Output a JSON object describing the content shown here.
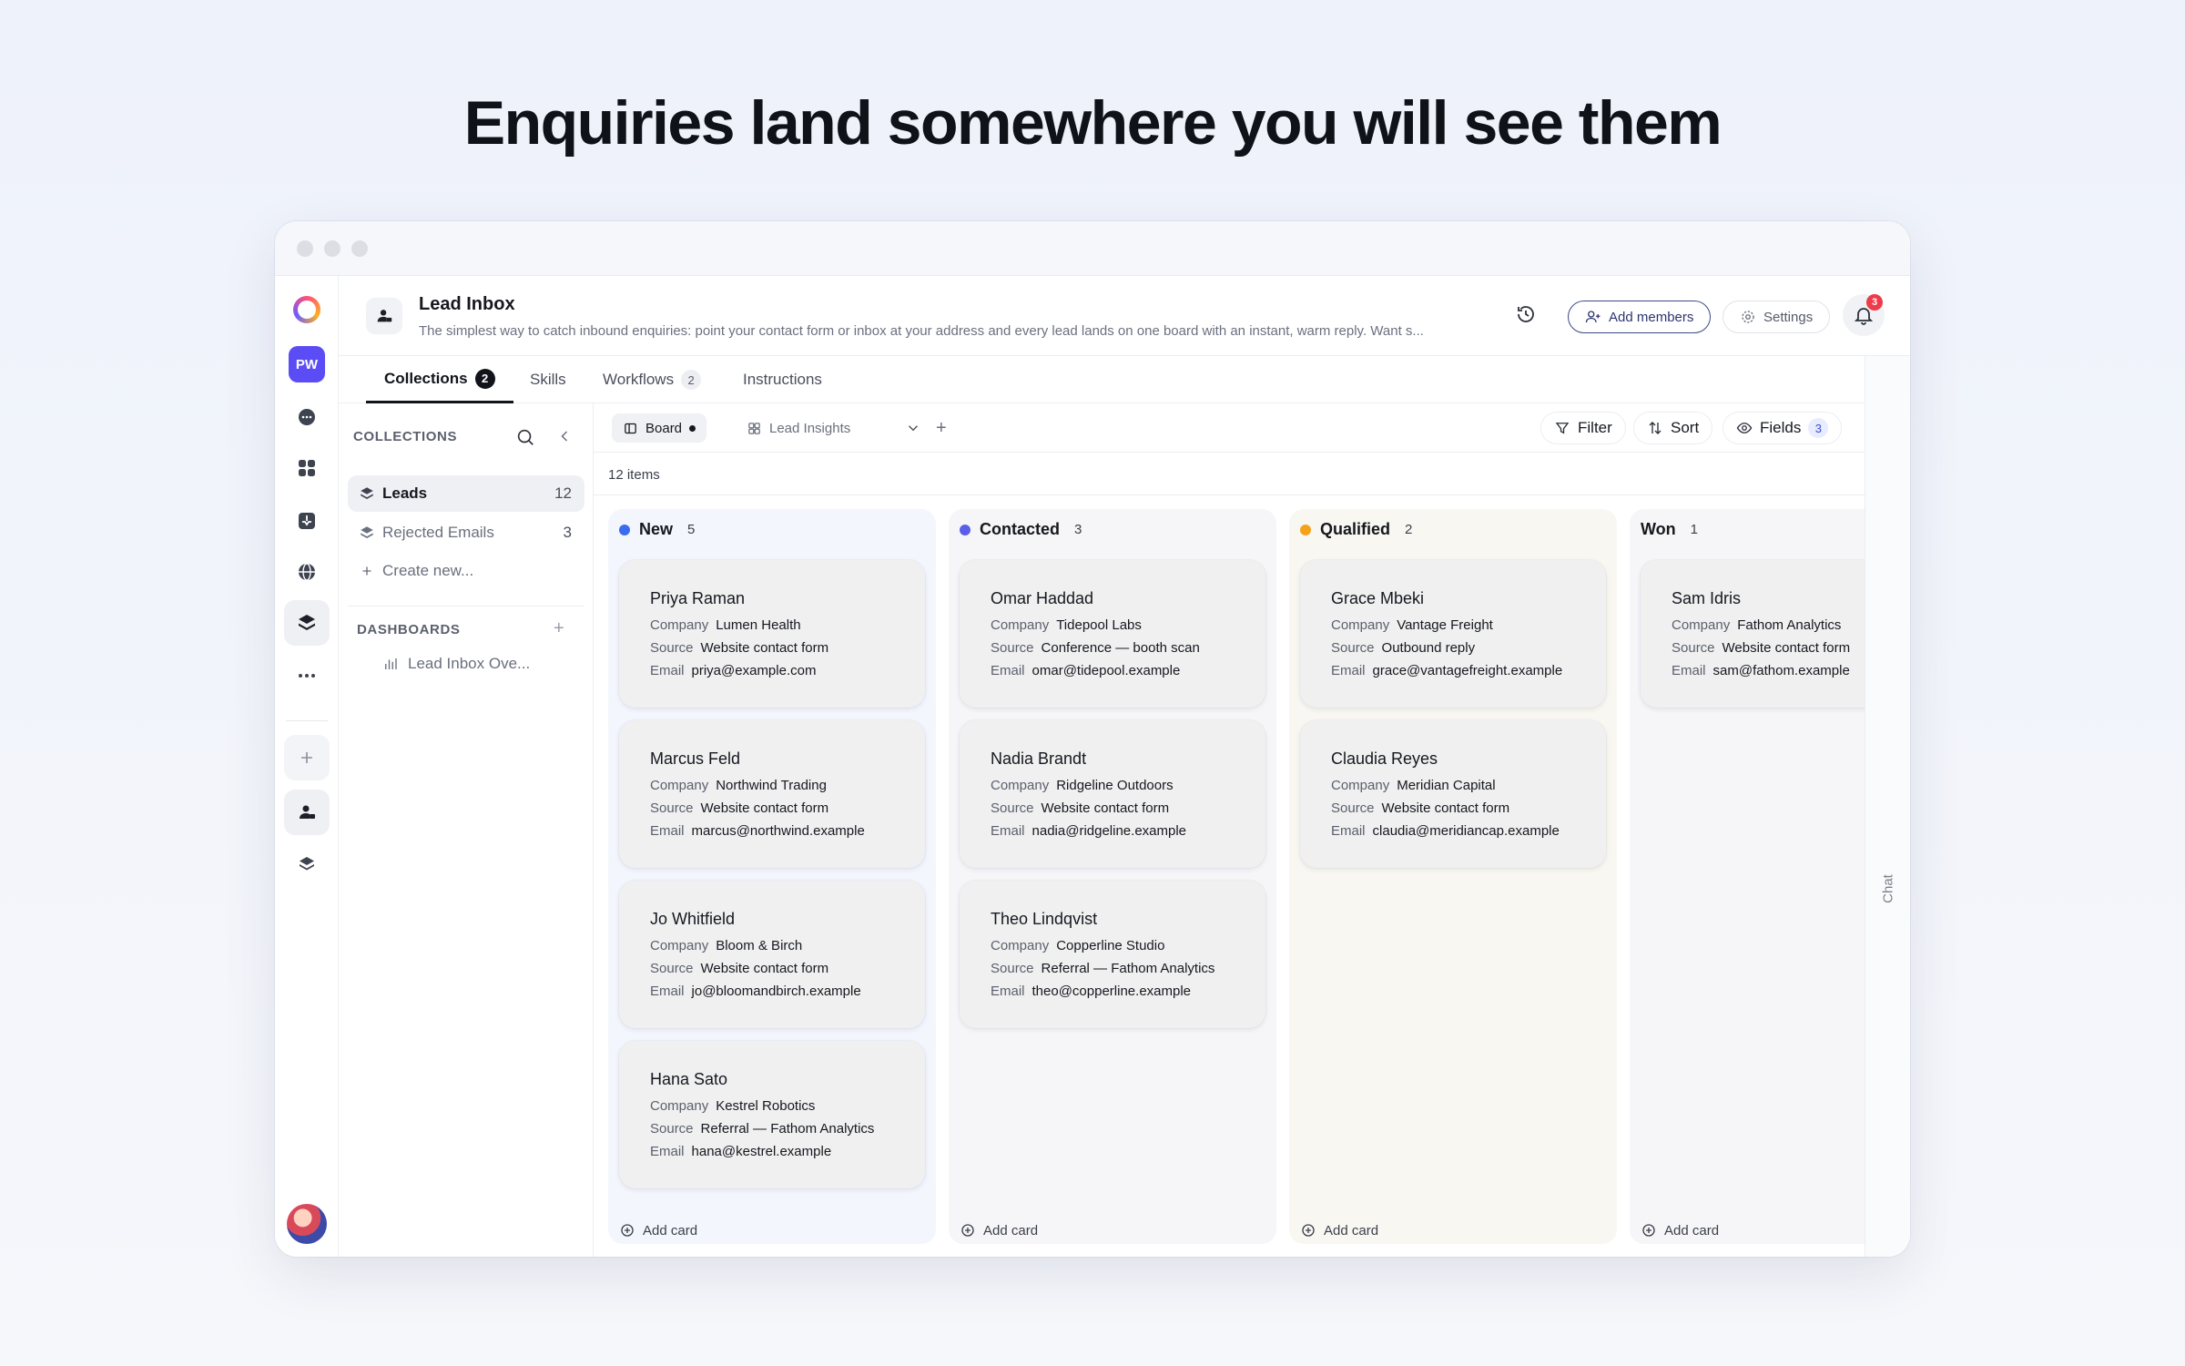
{
  "hero": {
    "title": "Enquiries land somewhere you will see them"
  },
  "rail": {
    "workspace_initials": "PW"
  },
  "header": {
    "title": "Lead Inbox",
    "description": "The simplest way to catch inbound enquiries: point your contact form or inbox at your address and every lead lands on one board with an instant, warm reply. Want s...",
    "add_members_label": "Add members",
    "settings_label": "Settings",
    "notification_count": "3"
  },
  "tabs": [
    {
      "label": "Collections",
      "count": "2"
    },
    {
      "label": "Skills"
    },
    {
      "label": "Workflows",
      "count": "2"
    },
    {
      "label": "Instructions"
    }
  ],
  "chat_label": "Chat",
  "collections": {
    "heading": "COLLECTIONS",
    "items": [
      {
        "label": "Leads",
        "count": "12"
      },
      {
        "label": "Rejected Emails",
        "count": "3"
      }
    ],
    "create_label": "Create new...",
    "dashboards_heading": "DASHBOARDS",
    "dashboards": [
      {
        "label": "Lead Inbox Ove..."
      }
    ]
  },
  "toolbar": {
    "views": [
      {
        "label": "Board"
      },
      {
        "label": "Lead Insights"
      }
    ],
    "filter_label": "Filter",
    "sort_label": "Sort",
    "fields_label": "Fields",
    "fields_count": "3"
  },
  "items_count": "12 items",
  "board": {
    "labels": {
      "company": "Company",
      "source": "Source",
      "email": "Email"
    },
    "add_card_label": "Add card",
    "columns": [
      {
        "name": "New",
        "count": "5",
        "dot_color": "#3b6cf0",
        "bg_color": "#f3f6fd",
        "cards": [
          {
            "name": "Priya Raman",
            "company": "Lumen Health",
            "source": "Website contact form",
            "email": "priya@example.com"
          },
          {
            "name": "Marcus Feld",
            "company": "Northwind Trading",
            "source": "Website contact form",
            "email": "marcus@northwind.example"
          },
          {
            "name": "Jo Whitfield",
            "company": "Bloom & Birch",
            "source": "Website contact form",
            "email": "jo@bloomandbirch.example"
          },
          {
            "name": "Hana Sato",
            "company": "Kestrel Robotics",
            "source": "Referral — Fathom Analytics",
            "email": "hana@kestrel.example"
          }
        ]
      },
      {
        "name": "Contacted",
        "count": "3",
        "dot_color": "#5a5ee8",
        "bg_color": "#f6f6f8",
        "cards": [
          {
            "name": "Omar Haddad",
            "company": "Tidepool Labs",
            "source": "Conference — booth scan",
            "email": "omar@tidepool.example"
          },
          {
            "name": "Nadia Brandt",
            "company": "Ridgeline Outdoors",
            "source": "Website contact form",
            "email": "nadia@ridgeline.example"
          },
          {
            "name": "Theo Lindqvist",
            "company": "Copperline Studio",
            "source": "Referral — Fathom Analytics",
            "email": "theo@copperline.example"
          }
        ]
      },
      {
        "name": "Qualified",
        "count": "2",
        "dot_color": "#f5a21b",
        "bg_color": "#f8f7f1",
        "cards": [
          {
            "name": "Grace Mbeki",
            "company": "Vantage Freight",
            "source": "Outbound reply",
            "email": "grace@vantagefreight.example"
          },
          {
            "name": "Claudia Reyes",
            "company": "Meridian Capital",
            "source": "Website contact form",
            "email": "claudia@meridiancap.example"
          }
        ]
      },
      {
        "name": "Won",
        "count": "1",
        "dot_color": "",
        "bg_color": "#f6f6f8",
        "cards": [
          {
            "name": "Sam Idris",
            "company": "Fathom Analytics",
            "source": "Website contact form",
            "email": "sam@fathom.example"
          }
        ]
      }
    ]
  }
}
